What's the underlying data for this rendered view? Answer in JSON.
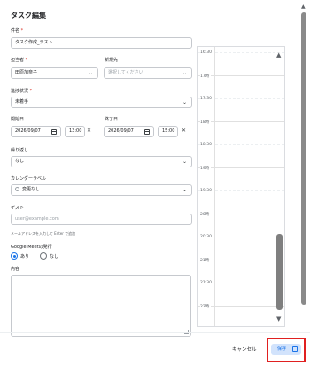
{
  "dialog": {
    "title": "タスク編集"
  },
  "fields": {
    "title": {
      "label": "件名",
      "required_mark": "*",
      "value": "タスク作成_テスト"
    },
    "assignee": {
      "label": "担当者",
      "required_mark": "*",
      "value": "田原加奈子"
    },
    "cc": {
      "label": "新規先",
      "placeholder": "選択してください"
    },
    "status": {
      "label": "進捗状況",
      "required_mark": "*",
      "value": "未着手"
    },
    "start": {
      "label": "開始日",
      "date": "2026/09/07",
      "time": "13:00"
    },
    "end": {
      "label": "終了日",
      "date": "2026/09/07",
      "time": "15:00"
    },
    "repeat": {
      "label": "繰り返し",
      "value": "なし"
    },
    "calendar_label": {
      "label": "カレンダーラベル",
      "value": "変更なし"
    },
    "guest": {
      "label": "ゲスト",
      "placeholder": "user@example.com",
      "hint": "メールアドレスを入力して Enter で追加"
    },
    "meet": {
      "label": "Google Meetの発行",
      "options": [
        "あり",
        "なし"
      ],
      "selected": "あり"
    },
    "content": {
      "label": "内容",
      "value": ""
    }
  },
  "timeline": {
    "times": [
      "16:30",
      "17時",
      "17:30",
      "18時",
      "18:30",
      "19時",
      "19:30",
      "20時",
      "20:30",
      "21時",
      "21:30",
      "22時"
    ]
  },
  "footer": {
    "cancel_label": "キャンセル",
    "save_label": "保存"
  },
  "icons": {
    "dropdown": "chevron-down-icon",
    "date": "calendar-icon",
    "clear": "close-icon",
    "save": "save-icon",
    "scroll_up": "triangle-up-icon",
    "scroll_down": "triangle-down-icon"
  },
  "colors": {
    "accent": "#1a73e8",
    "required": "#d93025",
    "highlight_border": "#e02020",
    "save_bg": "#d2e3fc"
  }
}
